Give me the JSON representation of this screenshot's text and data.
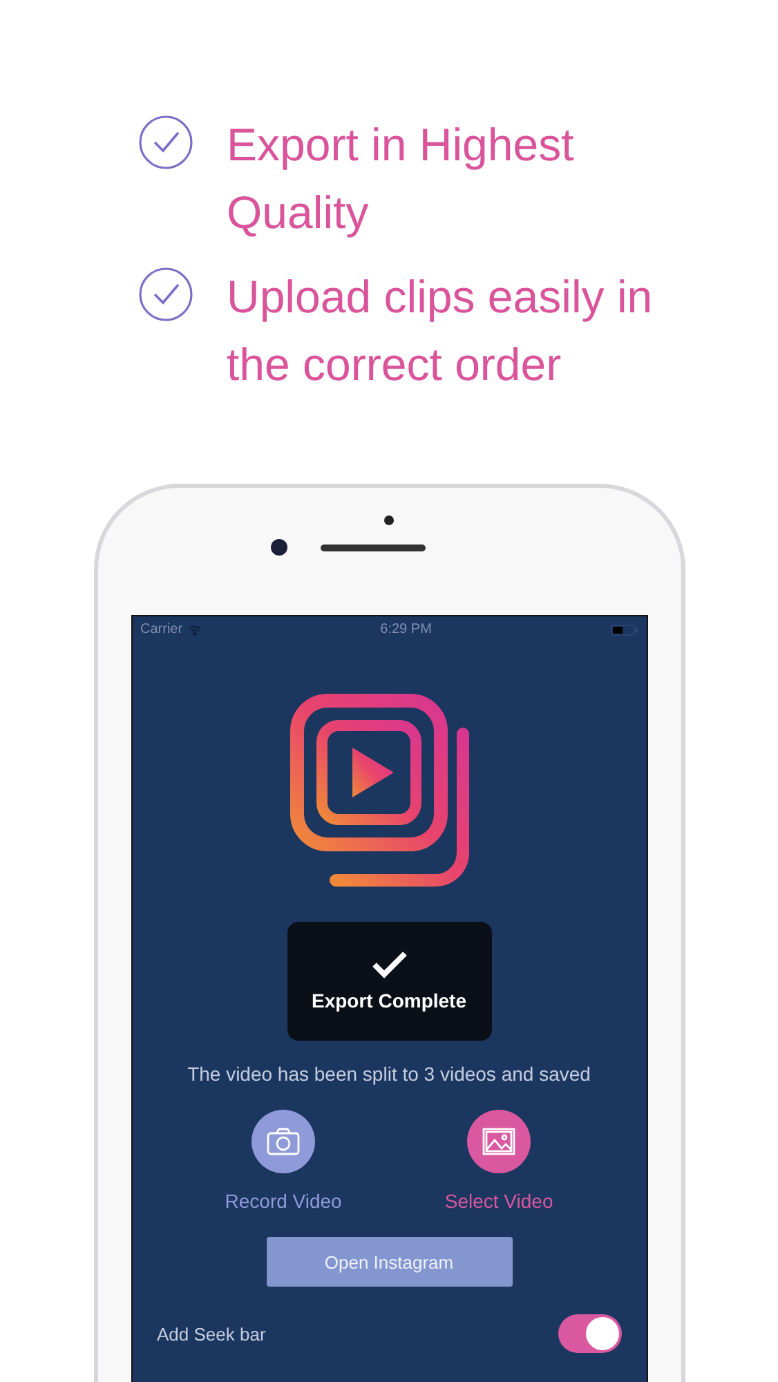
{
  "features": [
    {
      "text": "Export in Highest Quality",
      "checked": true
    },
    {
      "text": "Upload clips easily in the correct order",
      "checked": true
    }
  ],
  "status_bar": {
    "carrier": "Carrier",
    "time": "6:29 PM"
  },
  "hud": {
    "title": "Export Complete"
  },
  "message": "The video has been split to 3 videos and saved",
  "actions": [
    {
      "label": "Record Video",
      "kind": "camera",
      "color": "#8f9ad8"
    },
    {
      "label": "Select Video",
      "kind": "gallery",
      "color": "#d9589f"
    }
  ],
  "open_button": "Open Instagram",
  "setting": {
    "label": "Add Seek bar",
    "on": true
  }
}
